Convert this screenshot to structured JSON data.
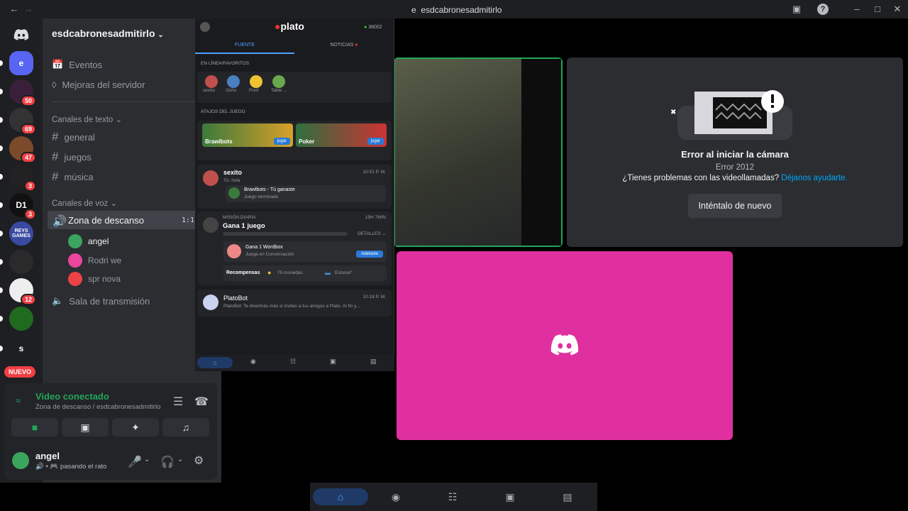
{
  "window": {
    "title": "esdcabronesadmitirlo",
    "tab_icon": "e"
  },
  "guilds": [
    {
      "label": "e",
      "color": "#5865f2",
      "badge": ""
    },
    {
      "label": "",
      "color": "#3a1f3a",
      "badge": "50"
    },
    {
      "label": "",
      "color": "#333",
      "badge": "69"
    },
    {
      "label": "",
      "color": "#7a4a2a",
      "badge": "47"
    },
    {
      "label": "",
      "color": "#222",
      "badge": "3"
    },
    {
      "label": "D1",
      "color": "#111",
      "badge": "3"
    },
    {
      "label": "REYS GAMES",
      "color": "#3a4aa0",
      "badge": ""
    },
    {
      "label": "",
      "color": "#2a2a2a",
      "badge": ""
    },
    {
      "label": "",
      "color": "#eee",
      "badge": "12"
    },
    {
      "label": "",
      "color": "#1f6a1f",
      "badge": ""
    },
    {
      "label": "s",
      "color": "#1e1f22",
      "badge": ""
    }
  ],
  "new_badge": "NUEVO",
  "server": {
    "name": "esdcabronesadmitirlo",
    "events": "Eventos",
    "boosts": "Mejoras del servidor",
    "text_category": "Canales de texto",
    "text_channels": [
      "general",
      "juegos",
      "música"
    ],
    "voice_category": "Canales de voz",
    "voice_channel": "Zona de descanso",
    "voice_timer": "1:1",
    "voice_users": [
      {
        "name": "angel",
        "color": "#3ba55d"
      },
      {
        "name": "Rodri we",
        "color": "#eb459e"
      },
      {
        "name": "spr nova",
        "color": "#ed4245"
      }
    ],
    "stage_channel": "Sala de transmisión"
  },
  "voice_panel": {
    "status": "Video conectado",
    "location": "Zona de descanso / esdcabronesadmitirlo"
  },
  "user": {
    "name": "angel",
    "status": "pasando el rato"
  },
  "plato": {
    "logo": "plato",
    "coins": "38002",
    "tabs": [
      "FUENTE",
      "NOTICIAS"
    ],
    "online_label": "EN LÍNEA/FAVORITOS",
    "online": [
      {
        "name": "sexito",
        "color": "#c0504d"
      },
      {
        "name": "Ocho",
        "color": "#4a7fc0"
      },
      {
        "name": "Pool",
        "color": "#f1c232"
      },
      {
        "name": "Table ...",
        "color": "#6aa84f"
      }
    ],
    "shortcuts_label": "ATAJOS DEL JUEGO",
    "games": [
      {
        "name": "Brawlbots",
        "btn": "jugar"
      },
      {
        "name": "Poker",
        "btn": "jugar"
      }
    ],
    "chat1": {
      "name": "sexito",
      "time": "10:51 P. M.",
      "msg": "Tú: hola",
      "game": "Brawlbots - Tú ganaste",
      "sub": "Juego terminado"
    },
    "mission": {
      "label": "MISIÓN DIARIA",
      "time": "19H 7MIN",
      "title": "Gana 1 juego",
      "details": "DETALLES",
      "task": "Gana 1 Wordbox",
      "task_sub": "Juega en Conversación",
      "task_btn": "Adelante",
      "rewards": "Recompensas",
      "coins": "75 monedas",
      "flag": "Estonia*"
    },
    "chat2": {
      "name": "PlatoBot",
      "time": "10:18 P. M.",
      "msg": "PlatoBot: Te divertirás más si invitas a tus amigos a Plato. Al fin y..."
    }
  },
  "camera_error": {
    "title": "Error al iniciar la cámara",
    "code": "Error 2012",
    "help": "¿Tienes problemas con las videollamadas?",
    "link": "Déjanos ayudarte.",
    "button": "Inténtalo de nuevo"
  },
  "colors": {
    "accent": "#5865f2",
    "green": "#23a55a",
    "pink": "#e0309f",
    "badge": "#f23f43"
  }
}
